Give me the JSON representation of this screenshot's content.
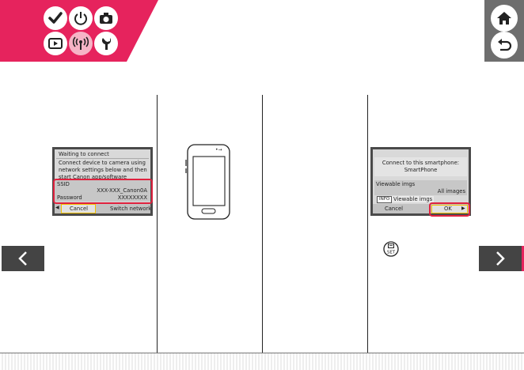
{
  "header": {
    "icons": [
      {
        "name": "shooting-check-icon",
        "active": false
      },
      {
        "name": "power-icon",
        "active": false
      },
      {
        "name": "camera-icon",
        "active": false
      },
      {
        "name": "playback-icon",
        "active": false
      },
      {
        "name": "wireless-icon",
        "active": true
      },
      {
        "name": "settings-wrench-icon",
        "active": false
      }
    ],
    "home_icon": "home-icon",
    "back_icon": "return-icon",
    "colors": {
      "banner": "#e6235d",
      "panel": "#6e6e6e"
    }
  },
  "camera_screen_1": {
    "title": "Waiting to connect",
    "line1": "Connect device to camera using",
    "line2": "network settings below and then",
    "line3": "start Canon app/software",
    "ssid_label": "SSID",
    "ssid_value": "XXX-XXX_Canon0A",
    "password_label": "Password",
    "password_value": "XXXXXXXX",
    "cancel_label": "Cancel",
    "switch_label": "Switch network",
    "highlight_color": "#e0223f"
  },
  "camera_screen_2": {
    "line1": "Connect to this smartphone:",
    "line2": "SmartPhone",
    "viewable_label": "Viewable imgs",
    "viewable_value": "All images",
    "info_label": "INFO",
    "info_text": "Viewable imgs",
    "cancel_label": "Cancel",
    "ok_label": "OK"
  },
  "set_button_label": "SET",
  "nav": {
    "prev_icon": "chevron-left-icon",
    "next_icon": "chevron-right-icon"
  }
}
